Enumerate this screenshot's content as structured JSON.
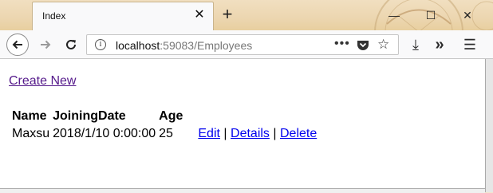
{
  "window": {
    "tab_title": "Index",
    "close_tab_glyph": "✕",
    "new_tab_glyph": "+",
    "minimize_glyph": "—",
    "maximize_glyph": "☐",
    "close_window_glyph": "✕"
  },
  "navbar": {
    "url_host": "localhost",
    "url_path": ":59083/Employees",
    "page_actions_glyph": "•••",
    "bookmark_glyph": "☆",
    "download_glyph": "⤓",
    "overflow_glyph": "»",
    "menu_glyph": "☰"
  },
  "page": {
    "create_new": "Create New",
    "table": {
      "headers": [
        "Name",
        "JoiningDate",
        "Age"
      ],
      "rows": [
        {
          "name": "Maxsu",
          "joining_date": "2018/1/10 0:00:00",
          "age": "25",
          "edit": "Edit",
          "details": "Details",
          "delete": "Delete",
          "sep": "|"
        }
      ]
    }
  },
  "colors": {
    "link": "#0000ee",
    "visited_link": "#551a8b",
    "theme_tan": "#ecd6b0"
  }
}
